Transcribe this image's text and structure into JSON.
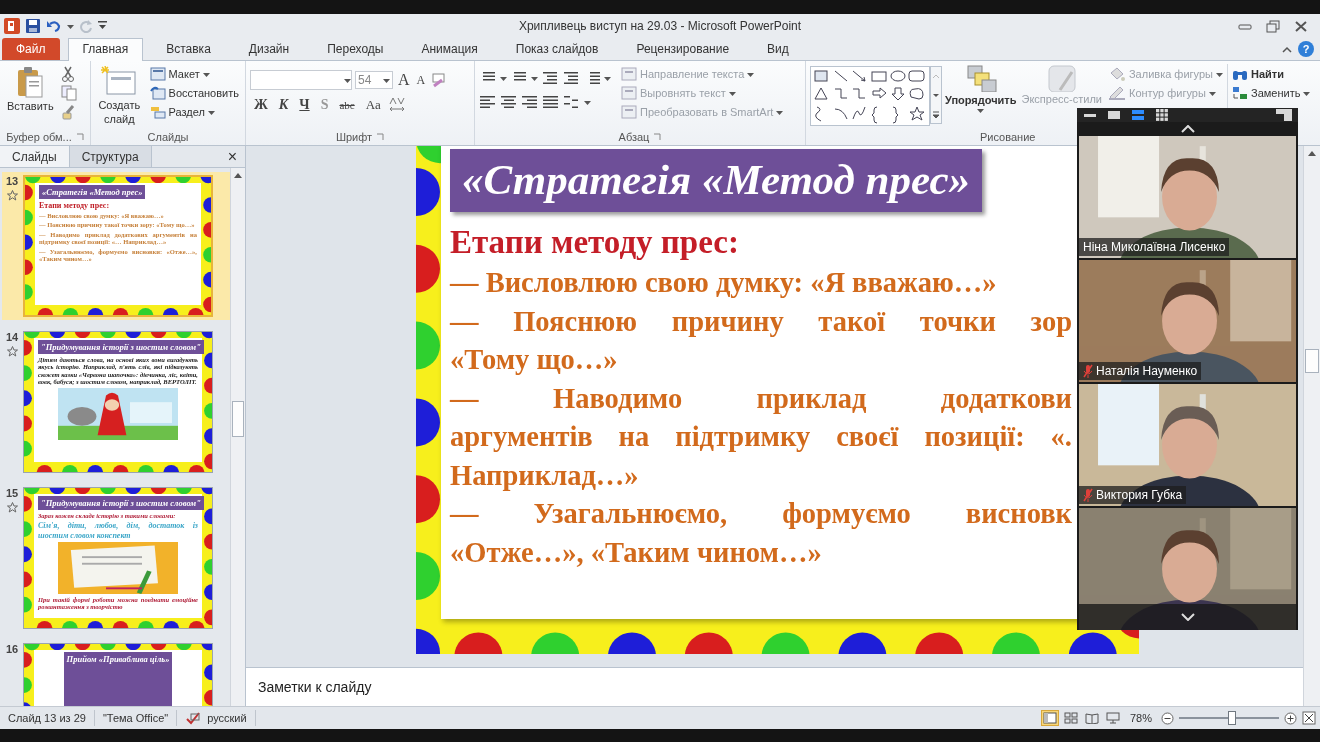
{
  "window": {
    "title": "Хрипливець виступ на 29.03  -  Microsoft PowerPoint",
    "help": "?"
  },
  "tabs": [
    {
      "label": "Файл",
      "kind": "file",
      "selected": false
    },
    {
      "label": "Главная",
      "kind": "tab",
      "selected": true
    },
    {
      "label": "Вставка",
      "kind": "tab",
      "selected": false
    },
    {
      "label": "Дизайн",
      "kind": "tab",
      "selected": false
    },
    {
      "label": "Переходы",
      "kind": "tab",
      "selected": false
    },
    {
      "label": "Анимация",
      "kind": "tab",
      "selected": false
    },
    {
      "label": "Показ слайдов",
      "kind": "tab",
      "selected": false
    },
    {
      "label": "Рецензирование",
      "kind": "tab",
      "selected": false
    },
    {
      "label": "Вид",
      "kind": "tab",
      "selected": false
    }
  ],
  "ribbon": {
    "clipboard": {
      "label": "Буфер обм...",
      "paste": "Вставить"
    },
    "slides": {
      "label": "Слайды",
      "new_slide": "Создать слайд",
      "layout": "Макет",
      "reset": "Восстановить",
      "section": "Раздел"
    },
    "font": {
      "label": "Шрифт",
      "size": "54",
      "size_buttons": [
        "A",
        "A"
      ],
      "format_buttons": [
        "Ж",
        "К",
        "Ч",
        "S",
        "abc",
        "Aa"
      ]
    },
    "paragraph": {
      "label": "Абзац",
      "commands": [
        {
          "label": "Направление текста",
          "disabled": true
        },
        {
          "label": "Выровнять текст",
          "disabled": true
        },
        {
          "label": "Преобразовать в SmartArt",
          "disabled": true
        }
      ]
    },
    "drawing": {
      "label": "Рисование",
      "arrange": "Упорядочить",
      "quick_styles": "Экспресс-стили",
      "commands": [
        {
          "label": "Заливка фигуры",
          "disabled": true
        },
        {
          "label": "Контур фигуры",
          "disabled": true
        }
      ]
    },
    "editing": {
      "find": "Найти",
      "replace": "Заменить"
    }
  },
  "slides_panel": {
    "tabs": [
      {
        "label": "Слайды",
        "selected": true
      },
      {
        "label": "Структура",
        "selected": false
      }
    ],
    "close": "×",
    "thumbnails": [
      {
        "number": "13",
        "selected": true,
        "animated": true,
        "title": "«Стратегія «Метод прес»",
        "heading": "Етапи методу прес:",
        "body": [
          "— Висловлюю свою думку: «Я вважаю…»",
          "— Пояснюю причину такої точки зору: «Тому що…»",
          "— Наводимо приклад додаткових аргументів на підтримку своєї позиції: «… Наприклад…»",
          "— Узагальнюємо, формуємо висновки: «Отже…», «Таким чином…»"
        ]
      },
      {
        "number": "14",
        "selected": false,
        "animated": true,
        "title": "\"Придумування історії з шостим словом\"",
        "body": [
          "Дітям даються слова, на основі яких вони вигадують якусь історію. Наприклад, п'ять слів, які підказують сюжет казки «Червона шапочка»: дівчинка, ліс, квіти, вовк, бабуся; з шостим словом, наприклад, ВЕРТОЛІТ."
        ],
        "picture": {
          "kind": "picture"
        }
      },
      {
        "number": "15",
        "selected": false,
        "animated": true,
        "title": "\"Придумування історії з шостим словом\"",
        "body": [
          "Зараз кожен складе історію з такими словами:",
          "Сім'я, діти, любов, дім, достаток із шостим словом конспект"
        ],
        "picture": {
          "kind": "picture"
        },
        "footer": "При такій формі роботи можна поєднати емоційне розвантаження з творчістю"
      },
      {
        "number": "16",
        "selected": false,
        "animated": false,
        "title": "Прийом «Приваблива ціль»"
      }
    ]
  },
  "slide": {
    "title": "«Стратегія «Метод прес»",
    "heading": "Етапи методу прес:",
    "lines": [
      {
        "text": "— Висловлюю свою думку: «Я вважаю…»",
        "kind": "plain"
      },
      {
        "text": "— Пояснюю причину такої точки зор",
        "kind": "justified"
      },
      {
        "text": "«Тому що…»",
        "kind": "plain"
      },
      {
        "text": "— Наводимо приклад додаткови",
        "kind": "justified"
      },
      {
        "text": "аргументів на підтримку своєї позиції: «.",
        "kind": "justified"
      },
      {
        "text": "Наприклад…»",
        "kind": "plain"
      },
      {
        "text": "— Узагальнюємо, формуємо висновк",
        "kind": "justified"
      },
      {
        "text": "«Отже…», «Таким чином…»",
        "kind": "plain"
      }
    ]
  },
  "notes": {
    "placeholder": "Заметки к слайду"
  },
  "video_panel": {
    "view_modes": [
      {
        "selected": false
      },
      {
        "selected": false
      },
      {
        "selected": true
      },
      {
        "selected": false
      }
    ],
    "tiles": [
      {
        "name": "Ніна Миколаївна Лисенко",
        "muted": false
      },
      {
        "name": "Наталія Науменко",
        "muted": true
      },
      {
        "name": "Виктория Губка",
        "muted": true
      },
      {
        "muted": false
      }
    ]
  },
  "status_bar": {
    "slide": "Слайд 13 из 29",
    "theme": "\"Тема Office\"",
    "language": "русский",
    "zoom": {
      "label": "78%",
      "level": 0.53
    }
  }
}
